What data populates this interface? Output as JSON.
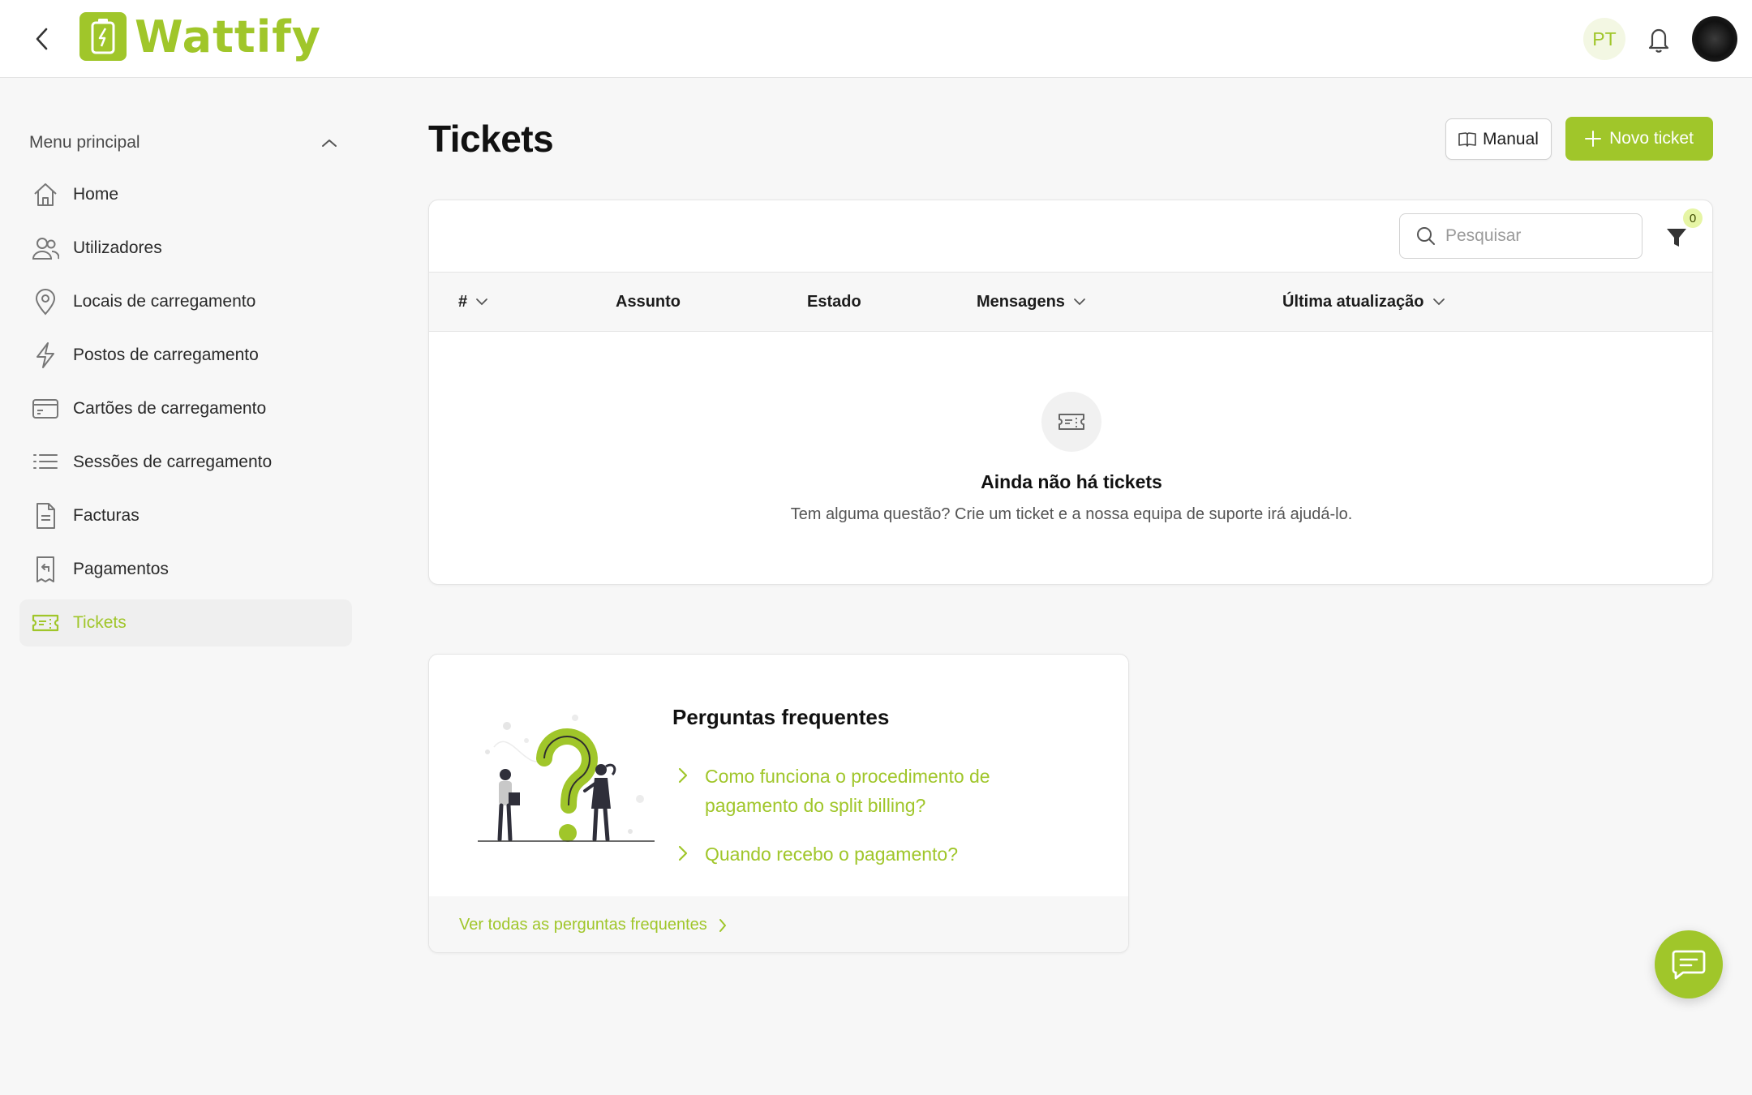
{
  "app": {
    "name": "Wattify",
    "language": "PT"
  },
  "header": {
    "back_icon": "chevron-left-icon",
    "notifications_icon": "bell-icon",
    "avatar": "user-avatar"
  },
  "sidebar": {
    "title": "Menu principal",
    "items": [
      {
        "label": "Home",
        "icon": "home-icon"
      },
      {
        "label": "Utilizadores",
        "icon": "users-icon"
      },
      {
        "label": "Locais de carregamento",
        "icon": "map-pin-icon"
      },
      {
        "label": "Postos de carregamento",
        "icon": "lightning-icon"
      },
      {
        "label": "Cartões de carregamento",
        "icon": "credit-card-icon"
      },
      {
        "label": "Sessões de carregamento",
        "icon": "list-icon"
      },
      {
        "label": "Facturas",
        "icon": "document-icon"
      },
      {
        "label": "Pagamentos",
        "icon": "receipt-icon"
      },
      {
        "label": "Tickets",
        "icon": "ticket-icon",
        "active": true
      }
    ]
  },
  "page": {
    "title": "Tickets",
    "manual_label": "Manual",
    "new_ticket_label": "Novo ticket"
  },
  "table": {
    "search_placeholder": "Pesquisar",
    "filter_count": "0",
    "columns": [
      "#",
      "Assunto",
      "Estado",
      "Mensagens",
      "Última atualização"
    ],
    "empty_title": "Ainda não há tickets",
    "empty_text": "Tem alguma questão? Crie um ticket e a nossa equipa de suporte irá ajudá-lo."
  },
  "faq": {
    "title": "Perguntas frequentes",
    "questions": [
      "Como funciona o procedimento de pagamento do split billing?",
      "Quando recebo o pagamento?"
    ],
    "see_all": "Ver todas as perguntas frequentes"
  },
  "colors": {
    "accent": "#a0c62a",
    "background": "#f7f7f7",
    "text": "#1c1c1c"
  }
}
